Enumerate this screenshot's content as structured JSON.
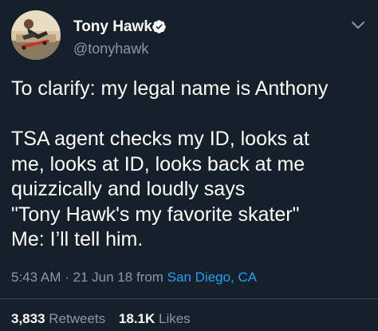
{
  "author": {
    "display_name": "Tony Hawk",
    "handle": "@tonyhawk",
    "verified": true,
    "avatar_icon": "skateboarder-avatar-icon"
  },
  "tweet": {
    "lines": [
      "To clarify: my legal name is Anthony",
      "",
      "TSA agent checks my ID, looks at",
      "me, looks at ID, looks back at me",
      "quizzically and loudly says",
      "\"Tony Hawk's my favorite skater\"",
      "Me: I’ll tell him."
    ],
    "time": "5:43 AM",
    "separator": "·",
    "date": "21 Jun 18",
    "from_label": "from",
    "location": "San Diego, CA"
  },
  "stats": {
    "retweets_count": "3,833",
    "retweets_label": "Retweets",
    "likes_count": "18.1K",
    "likes_label": "Likes"
  },
  "colors": {
    "background": "#15202b",
    "primary_text": "#ffffff",
    "secondary_text": "#8899a6",
    "link": "#1da1f2",
    "divider": "#38444d"
  }
}
